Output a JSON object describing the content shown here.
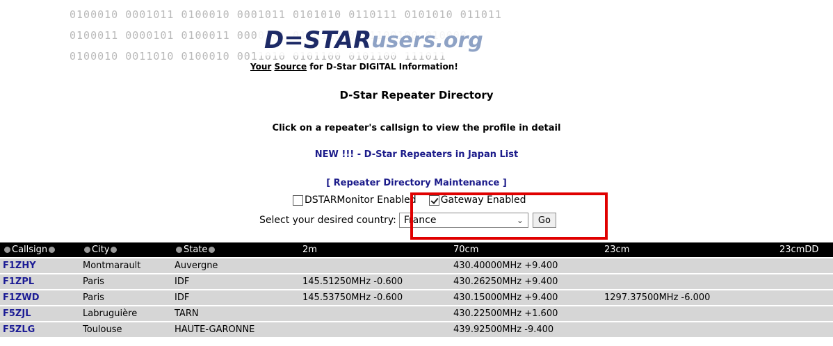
{
  "banner": {
    "binary_rows": [
      "0100010 0001011 0100010 0001011 0101010 0110111 0101010 011011",
      "0100011 0000101 0100011 0000101 0100110 0001100100 010000",
      "0100010 0011010 0100010 0011010 0101100 0101100 111011"
    ],
    "logo_d": "D",
    "logo_star": "=STAR",
    "logo_users": "users",
    "logo_org": ".org",
    "tagline_your": "Your",
    "tagline_source": "Source",
    "tagline_rest": "for D-Star DIGITAL Information!"
  },
  "headings": {
    "title": "D-Star Repeater Directory",
    "subtitle": "Click on a repeater's callsign to view the profile in detail",
    "new_link": "NEW !!! - D-Star Repeaters in Japan List",
    "maintenance_link": "[ Repeater Directory Maintenance ]"
  },
  "filters": {
    "dstarmonitor_label": "DSTARMonitor Enabled",
    "dstarmonitor_checked": false,
    "gateway_label": "Gateway Enabled",
    "gateway_checked": true,
    "country_label": "Select your desired country:",
    "country_value": "France",
    "go_label": "Go"
  },
  "table": {
    "columns": [
      "Callsign",
      "City",
      "State",
      "2m",
      "70cm",
      "23cm",
      "23cmDD"
    ],
    "rows": [
      [
        "F1ZHY",
        "Montmarault",
        "Auvergne",
        "",
        "430.40000MHz +9.400",
        "",
        ""
      ],
      [
        "F1ZPL",
        "Paris",
        "IDF",
        "145.51250MHz -0.600",
        "430.26250MHz +9.400",
        "",
        ""
      ],
      [
        "F1ZWD",
        "Paris",
        "IDF",
        "145.53750MHz -0.600",
        "430.15000MHz +9.400",
        "1297.37500MHz -6.000",
        ""
      ],
      [
        "F5ZJL",
        "Labruguière",
        "TARN",
        "",
        "430.22500MHz +1.600",
        "",
        ""
      ],
      [
        "F5ZLG",
        "Toulouse",
        "HAUTE-GARONNE",
        "",
        "439.92500MHz -9.400",
        "",
        ""
      ]
    ]
  },
  "colors": {
    "highlight": "#e00000",
    "link": "#1b1b8a",
    "header_bg": "#000000",
    "row_bg": "#d6d6d6"
  }
}
